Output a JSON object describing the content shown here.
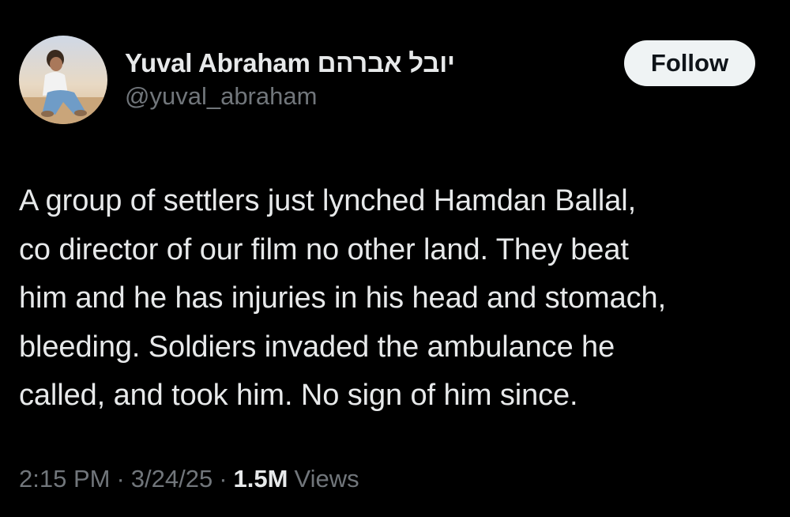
{
  "author": {
    "display_name": "Yuval Abraham יובל אברהם",
    "handle": "@yuval_abraham",
    "avatar_icon": "profile-photo-avatar"
  },
  "follow_button": {
    "label": "Follow"
  },
  "tweet": {
    "lines": [
      "A group of settlers just lynched Hamdan Ballal,",
      "co director of our film no other land. They beat",
      "him and he has injuries in his head and stomach,",
      "bleeding. Soldiers invaded the ambulance he",
      "called, and took him. No sign of him since."
    ]
  },
  "meta": {
    "time": "2:15 PM",
    "separator": "·",
    "date": "3/24/25",
    "views_count": "1.5M",
    "views_label": "Views"
  },
  "colors": {
    "background": "#000000",
    "primary_text": "#e7e9ea",
    "secondary_text": "#71767b",
    "follow_bg": "#eff3f4",
    "follow_text": "#0f1419"
  }
}
